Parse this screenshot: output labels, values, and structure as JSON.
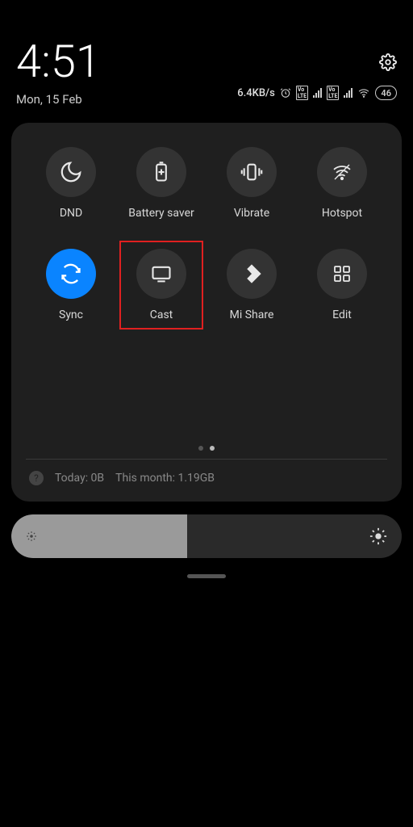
{
  "status": {
    "time": "4:51",
    "date": "Mon, 15 Feb",
    "net_speed": "6.4KB/s",
    "battery": "46"
  },
  "tiles": [
    {
      "label": "DND",
      "active": false,
      "highlight": false,
      "icon": "moon"
    },
    {
      "label": "Battery saver",
      "active": false,
      "highlight": false,
      "icon": "battery-plus"
    },
    {
      "label": "Vibrate",
      "active": false,
      "highlight": false,
      "icon": "vibrate"
    },
    {
      "label": "Hotspot",
      "active": false,
      "highlight": false,
      "icon": "hotspot"
    },
    {
      "label": "Sync",
      "active": true,
      "highlight": false,
      "icon": "sync"
    },
    {
      "label": "Cast",
      "active": false,
      "highlight": true,
      "icon": "cast"
    },
    {
      "label": "Mi Share",
      "active": false,
      "highlight": false,
      "icon": "share"
    },
    {
      "label": "Edit",
      "active": false,
      "highlight": false,
      "icon": "grid"
    }
  ],
  "data_usage": {
    "today": "Today: 0B",
    "month": "This month: 1.19GB"
  },
  "brightness_pct": 45
}
